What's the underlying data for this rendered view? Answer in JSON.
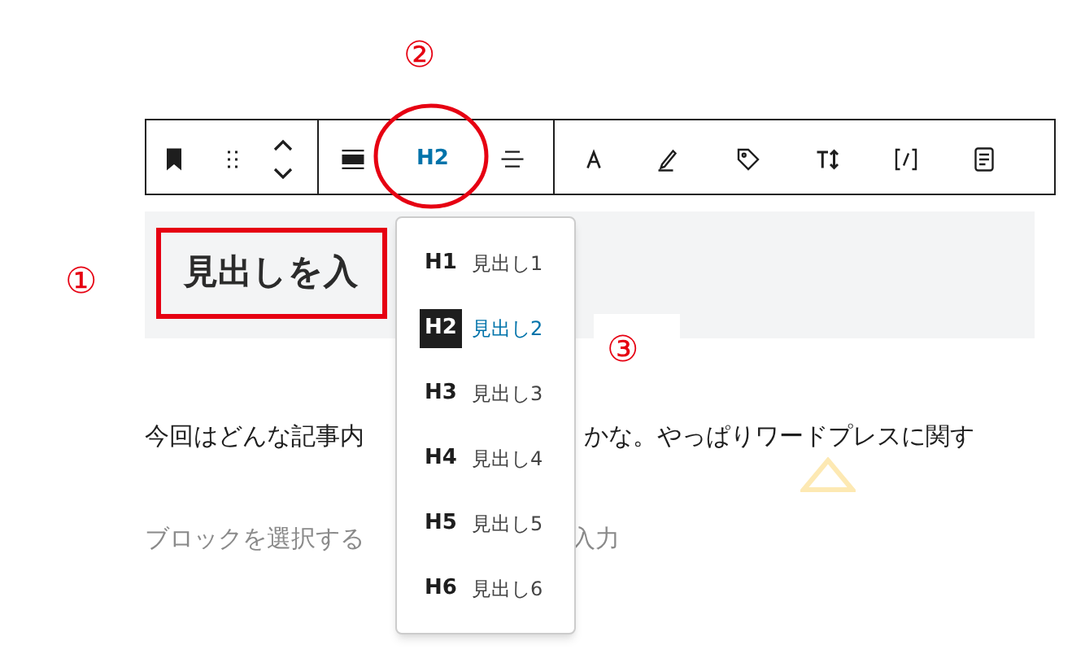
{
  "toolbar": {
    "heading_button": "H2"
  },
  "heading_block": {
    "text": "見出しを入"
  },
  "heading_menu": [
    {
      "tag": "H1",
      "label": "見出し1",
      "selected": false
    },
    {
      "tag": "H2",
      "label": "見出し2",
      "selected": true
    },
    {
      "tag": "H3",
      "label": "見出し3",
      "selected": false
    },
    {
      "tag": "H4",
      "label": "見出し4",
      "selected": false
    },
    {
      "tag": "H5",
      "label": "見出し5",
      "selected": false
    },
    {
      "tag": "H6",
      "label": "見出し6",
      "selected": false
    }
  ],
  "paragraph": {
    "visible_start": "今回はどんな記事内",
    "visible_end": "かな。やっぱりワードプレスに関す"
  },
  "block_prompt": {
    "visible_start": "ブロックを選択する",
    "visible_end": "入力"
  },
  "annotations": [
    "①",
    "②",
    "③"
  ]
}
